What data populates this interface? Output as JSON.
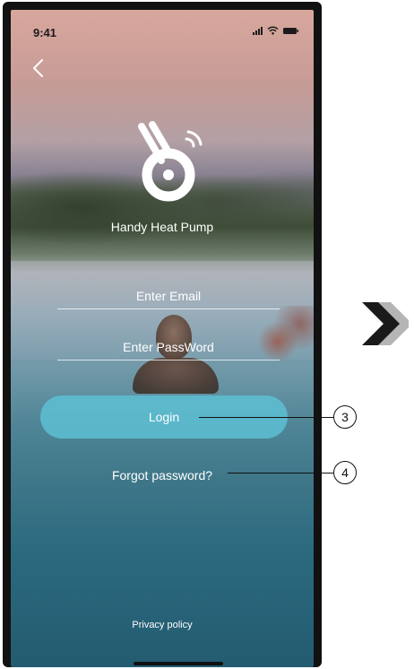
{
  "status_bar": {
    "time": "9:41"
  },
  "app": {
    "name": "Handy Heat Pump"
  },
  "form": {
    "email_placeholder": "Enter Email",
    "password_placeholder": "Enter PassWord",
    "login_label": "Login",
    "forgot_label": "Forgot password?"
  },
  "footer": {
    "privacy_label": "Privacy policy"
  },
  "callouts": {
    "login_number": "3",
    "forgot_number": "4"
  },
  "icons": {
    "back": "chevron-left-icon",
    "logo": "heat-pump-logo-icon",
    "next": "double-chevron-right-icon"
  },
  "colors": {
    "login_button": "#5dc0d2",
    "arrow_dark": "#1a1a1a",
    "arrow_light": "#b5b5b5"
  }
}
